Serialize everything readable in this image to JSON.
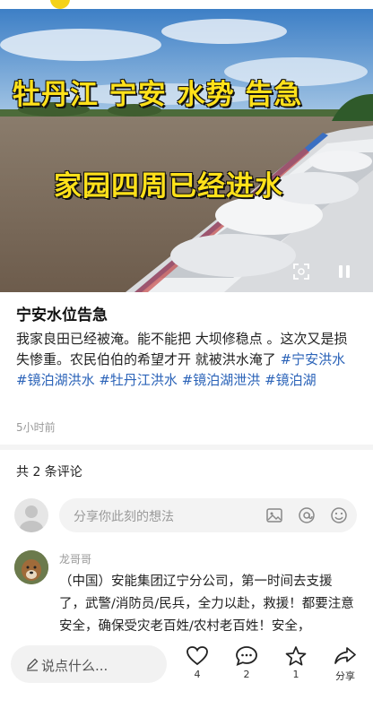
{
  "video": {
    "overlay_line1": "牡丹江  宁安 水势 告急",
    "overlay_line2": "家园四周已经进水",
    "scan_icon": "scan-icon",
    "pause_icon": "pause-icon"
  },
  "post": {
    "title": "宁安水位告急",
    "body": "我家良田已经被淹。能不能把 大坝修稳点  。这次又是损失惨重。农民伯伯的希望才开 就被洪水淹了",
    "tags": [
      "#宁安洪水",
      "#镜泊湖洪水",
      "#牡丹江洪水",
      "#镜泊湖泄洪",
      "#镜泊湖"
    ],
    "time": "5小时前",
    "tag_color": "#2b63b8"
  },
  "comments": {
    "count_label": "共 2 条评论",
    "input_placeholder": "分享你此刻的想法",
    "input_icons": [
      "image-icon",
      "at-icon",
      "emoji-icon"
    ],
    "items": [
      {
        "author": "龙哥哥",
        "text": "（中国）安能集团辽宁分公司，第一时间去支援了，武警/消防员/民兵，全力以赴，救援！都要注意安全，确保受灾老百姓/农村老百姓！安全，"
      }
    ]
  },
  "bottom_bar": {
    "say_placeholder": "说点什么...",
    "like_count": "4",
    "comment_count": "2",
    "star_count": "1",
    "share_label": "分享"
  }
}
